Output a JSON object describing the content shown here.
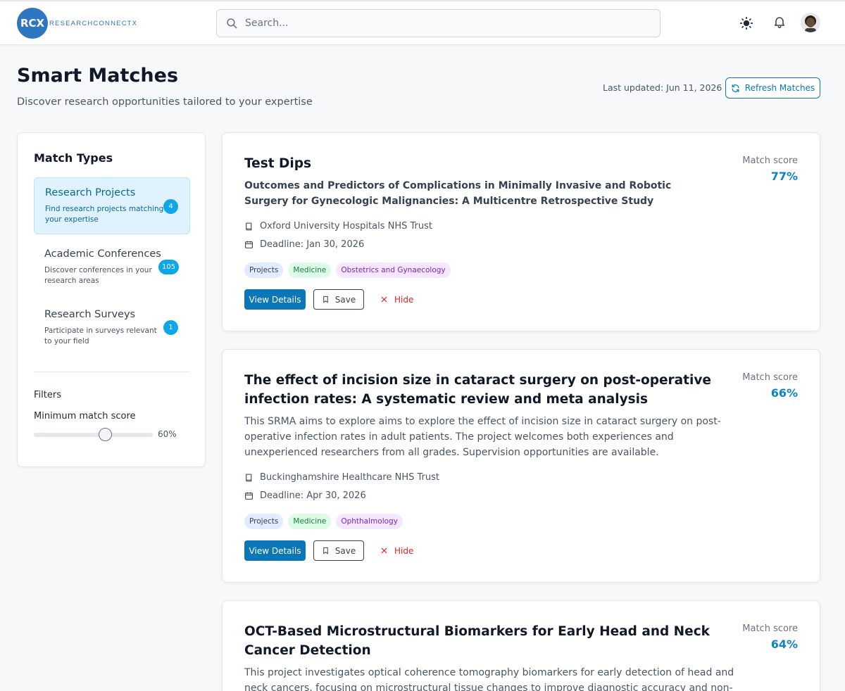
{
  "header": {
    "logo_mark": "RCX",
    "logo_text": "RESEARCHCONNECTX",
    "search_placeholder": "Search...",
    "icons": [
      "search-icon",
      "sun-icon",
      "bell-icon",
      "avatar"
    ]
  },
  "page": {
    "title": "Smart Matches",
    "subtitle": "Discover research opportunities tailored to your expertise",
    "last_updated": "Last updated: Jun 11, 2026",
    "refresh_label": "Refresh Matches"
  },
  "sidebar": {
    "title": "Match Types",
    "items": [
      {
        "label": "Research Projects",
        "desc": "Find research projects matching your expertise",
        "count": "4",
        "active": true
      },
      {
        "label": "Academic Conferences",
        "desc": "Discover conferences in your research areas",
        "count": "105",
        "active": false
      },
      {
        "label": "Research Surveys",
        "desc": "Participate in surveys relevant to your field",
        "count": "1",
        "active": false
      }
    ],
    "filters_label": "Filters",
    "min_score_label": "Minimum match score",
    "min_score_value": "60%",
    "min_score_fraction": 0.6
  },
  "cards": [
    {
      "title": "Test Dips",
      "subtitle": "Outcomes and Predictors of Complications in Minimally Invasive and Robotic Surgery for Gynecologic Malignancies: A Multicentre Retrospective Study",
      "score_label": "Match score",
      "score": "77%",
      "institution": "Oxford University Hospitals NHS Trust",
      "deadline": "Deadline: Jan 30, 2026",
      "tags": [
        "Projects",
        "Medicine",
        "Obstetrics and Gynaecology"
      ],
      "view_label": "View Details",
      "save_label": "Save",
      "hide_label": "Hide"
    },
    {
      "title": "The effect of incision size in cataract surgery on post-operative infection rates: A systematic review and meta analysis",
      "desc": "This SRMA aims to explore aims to explore the effect of incision size in cataract surgery on post-operative infection rates in adult patients. The project welcomes both experiences and unexperienced researchers from all grades. Supervision opportunities are available.",
      "score_label": "Match score",
      "score": "66%",
      "institution": "Buckinghamshire Healthcare NHS Trust",
      "deadline": "Deadline: Apr 30, 2026",
      "tags": [
        "Projects",
        "Medicine",
        "Ophthalmology"
      ],
      "view_label": "View Details",
      "save_label": "Save",
      "hide_label": "Hide"
    },
    {
      "title": "OCT-Based Microstructural Biomarkers for Early Head and Neck Cancer Detection",
      "desc": "This project investigates optical coherence tomography biomarkers for early detection of head and neck cancers, focusing on microstructural tissue changes to improve diagnostic accuracy and non-invasive",
      "score_label": "Match score",
      "score": "64%"
    }
  ]
}
